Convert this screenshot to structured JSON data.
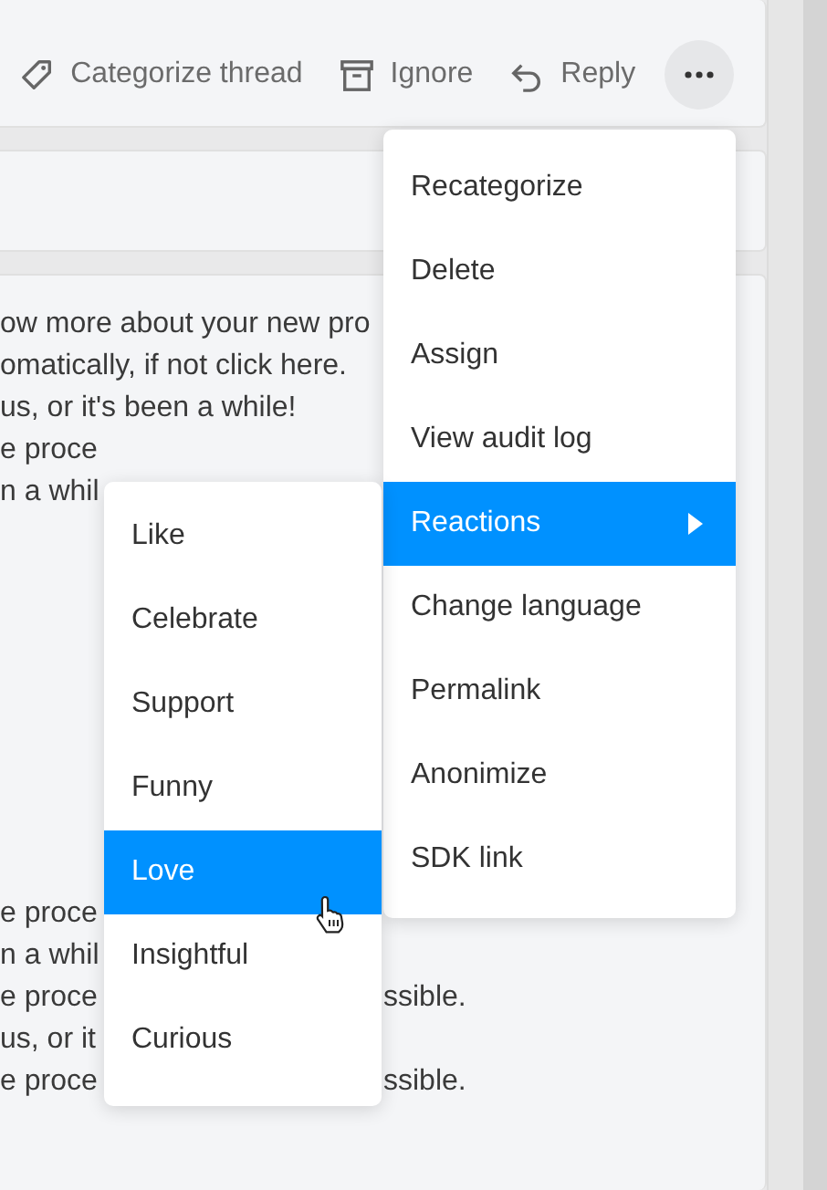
{
  "toolbar": [
    {
      "kind": "tag",
      "label": "Categorize thread"
    },
    {
      "kind": "archive",
      "label": "Ignore"
    },
    {
      "kind": "reply",
      "label": "Reply"
    }
  ],
  "paragraphs": [
    {
      "lines": [
        {
          "left": "ow more about your new pro"
        },
        {
          "left": "omatically, if not click here."
        },
        {
          "left": "us, or it's been a while!"
        },
        {
          "left": "e proce"
        },
        {
          "left": "n a whil"
        }
      ]
    },
    {
      "lines": [
        {
          "left": "e proce"
        },
        {
          "left": "n a whil"
        },
        {
          "left": "e proce",
          "right": "ssible."
        },
        {
          "left": "us, or it"
        },
        {
          "left": "e proce",
          "right": "ssible."
        }
      ]
    }
  ],
  "menu": {
    "items": [
      {
        "label": "Recategorize",
        "selected": false,
        "submenu": false
      },
      {
        "label": "Delete",
        "selected": false,
        "submenu": false
      },
      {
        "label": "Assign",
        "selected": false,
        "submenu": false
      },
      {
        "label": "View audit log",
        "selected": false,
        "submenu": false
      },
      {
        "label": "Reactions",
        "selected": true,
        "submenu": true
      },
      {
        "label": "Change language",
        "selected": false,
        "submenu": false
      },
      {
        "label": "Permalink",
        "selected": false,
        "submenu": false
      },
      {
        "label": "Anonimize",
        "selected": false,
        "submenu": false
      },
      {
        "label": "SDK link",
        "selected": false,
        "submenu": false
      }
    ]
  },
  "submenu": {
    "items": [
      {
        "label": "Like",
        "selected": false
      },
      {
        "label": "Celebrate",
        "selected": false
      },
      {
        "label": "Support",
        "selected": false
      },
      {
        "label": "Funny",
        "selected": false
      },
      {
        "label": "Love",
        "selected": true
      },
      {
        "label": "Insightful",
        "selected": false
      },
      {
        "label": "Curious",
        "selected": false
      }
    ]
  }
}
